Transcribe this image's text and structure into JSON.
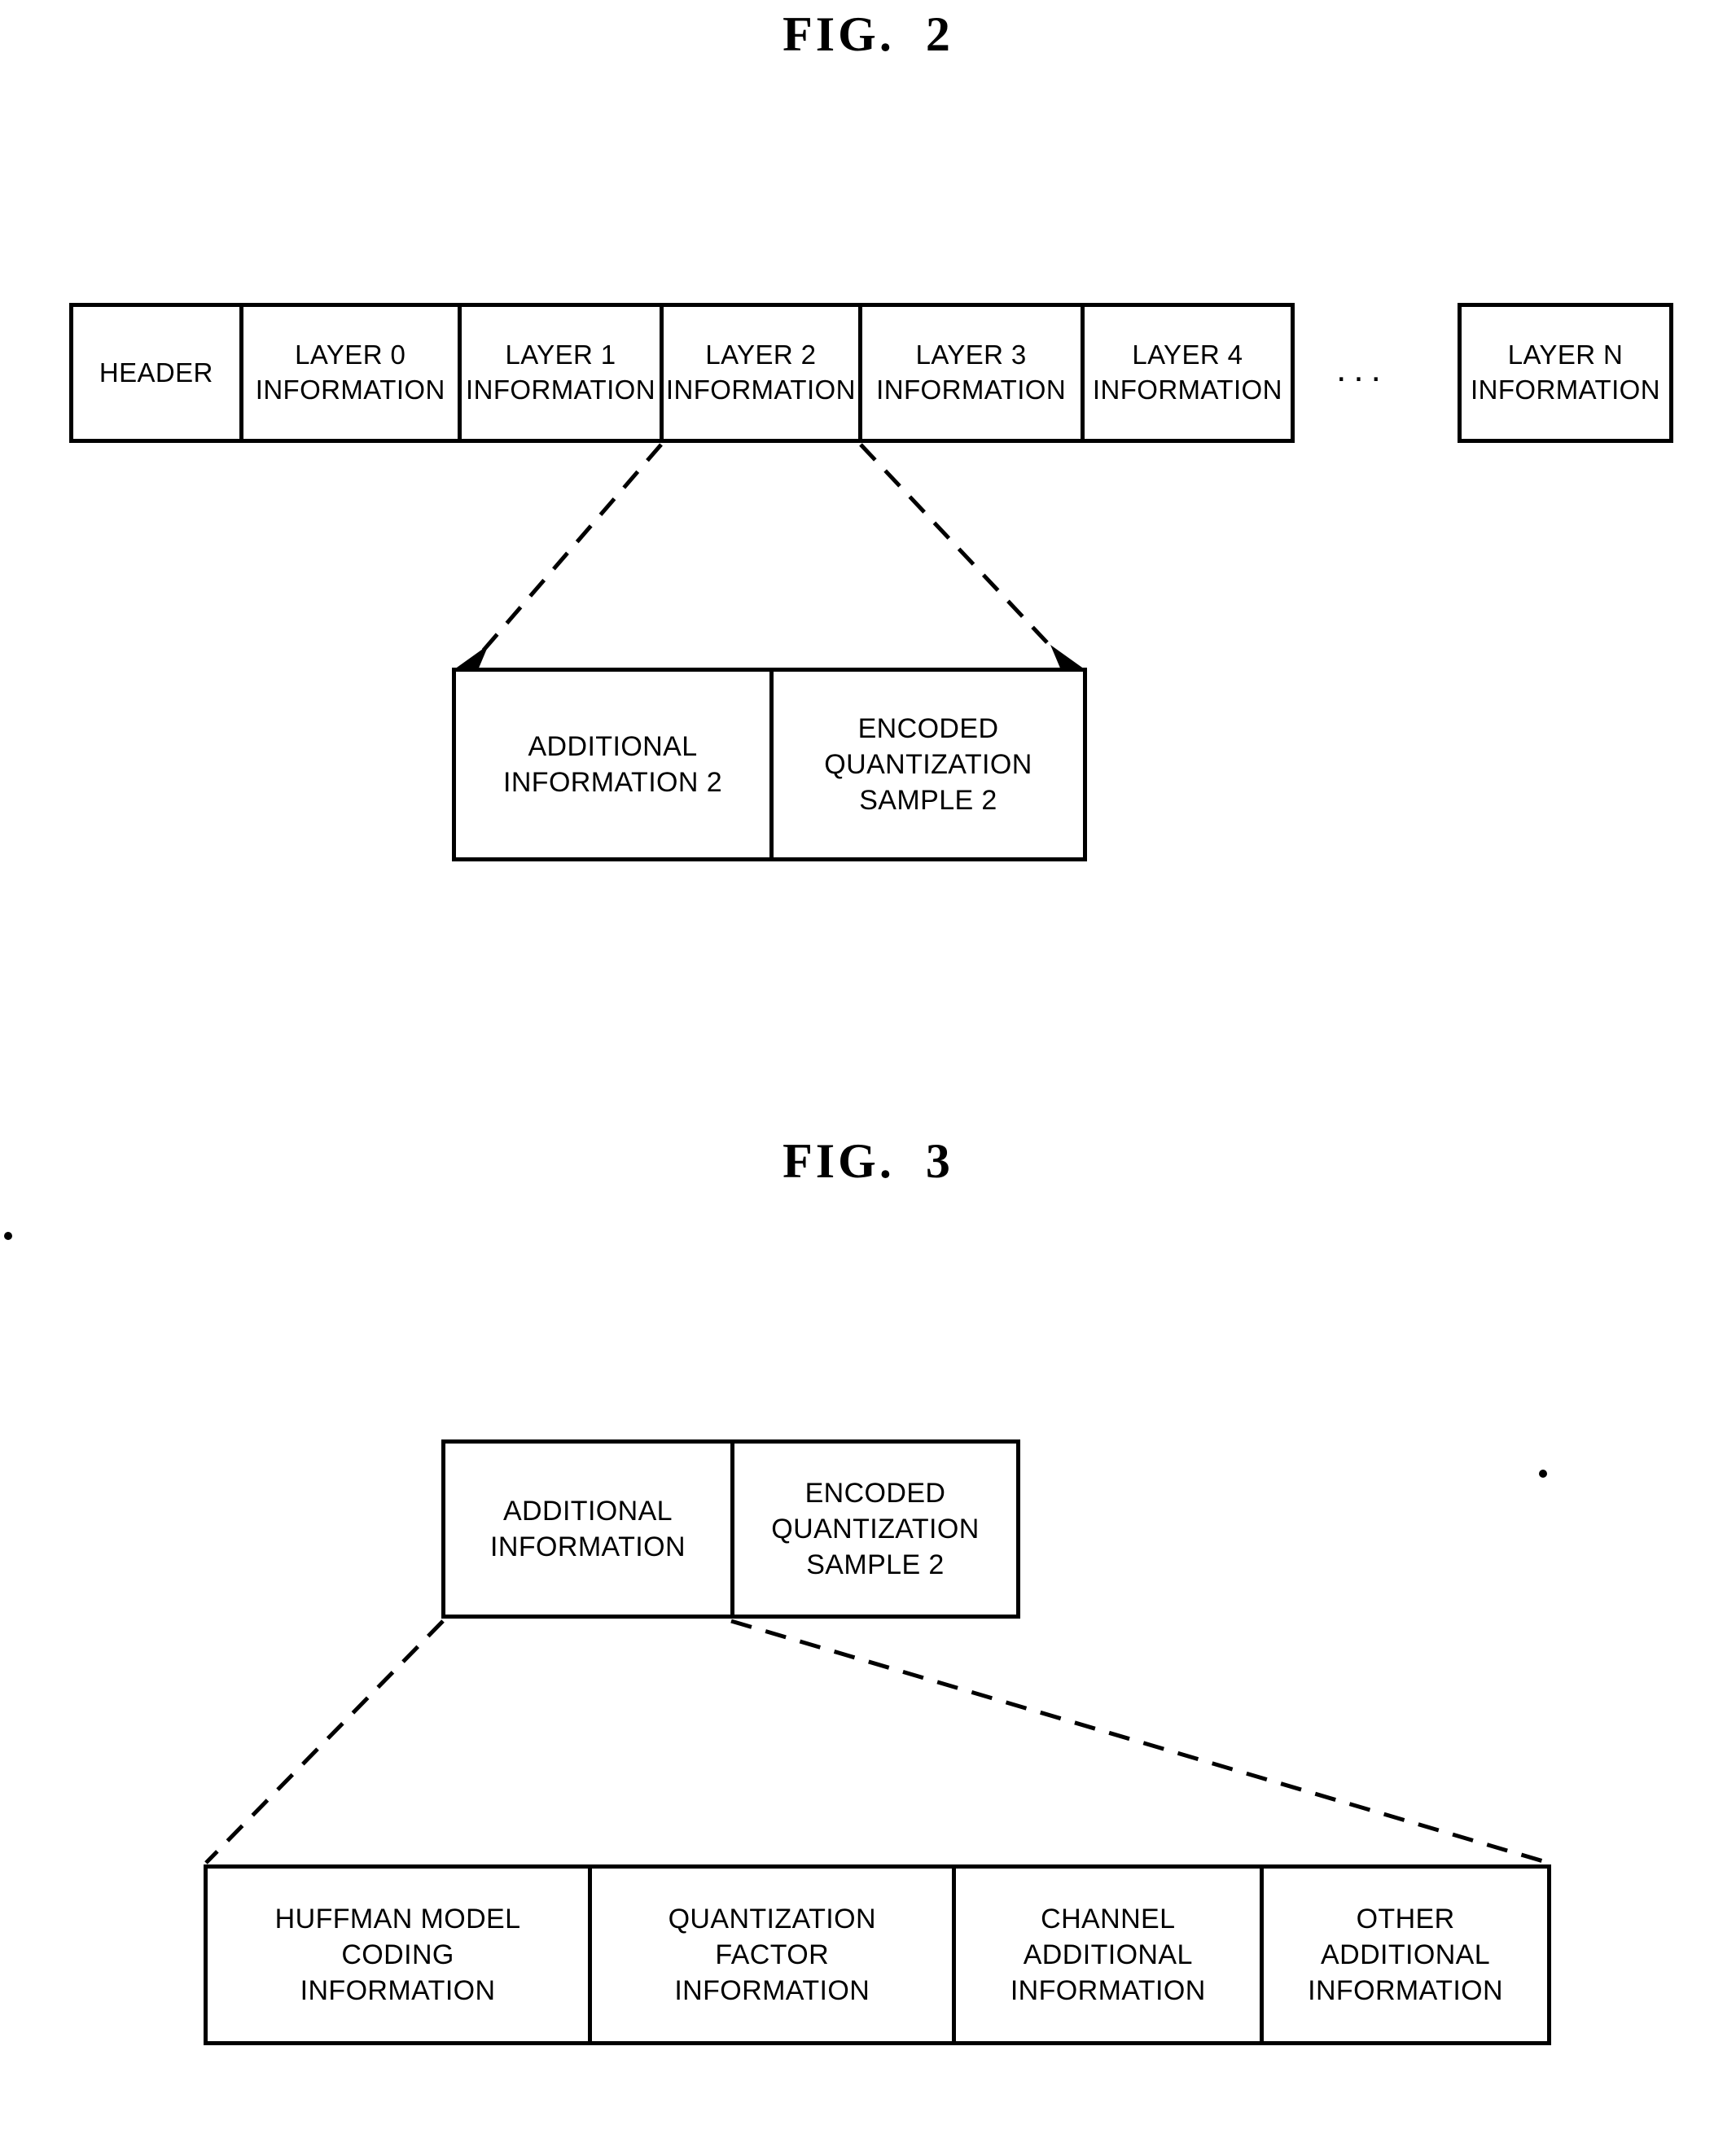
{
  "figures": [
    {
      "title": "FIG.  2",
      "stream_row": {
        "cells": [
          {
            "label": "HEADER"
          },
          {
            "label": "LAYER 0\nINFORMATION"
          },
          {
            "label": "LAYER 1\nINFORMATION"
          },
          {
            "label": "LAYER 2\nINFORMATION"
          },
          {
            "label": "LAYER 3\nINFORMATION"
          },
          {
            "label": "LAYER 4\nINFORMATION"
          }
        ],
        "ellipsis": "...",
        "last_cell": {
          "label": "LAYER N\nINFORMATION"
        }
      },
      "detail_box": {
        "cells": [
          {
            "label": "ADDITIONAL\nINFORMATION 2"
          },
          {
            "label": "ENCODED\nQUANTIZATION\nSAMPLE 2"
          }
        ]
      }
    },
    {
      "title": "FIG.  3",
      "detail_box": {
        "cells": [
          {
            "label": "ADDITIONAL\nINFORMATION"
          },
          {
            "label": "ENCODED\nQUANTIZATION\nSAMPLE 2"
          }
        ]
      },
      "additional_info_row": {
        "cells": [
          {
            "label": "HUFFMAN MODEL\nCODING\nINFORMATION"
          },
          {
            "label": "QUANTIZATION\nFACTOR\nINFORMATION"
          },
          {
            "label": "CHANNEL\nADDITIONAL\nINFORMATION"
          },
          {
            "label": "OTHER\nADDITIONAL\nINFORMATION"
          }
        ]
      }
    }
  ],
  "colors": {
    "ink": "#000000",
    "paper": "#ffffff"
  }
}
